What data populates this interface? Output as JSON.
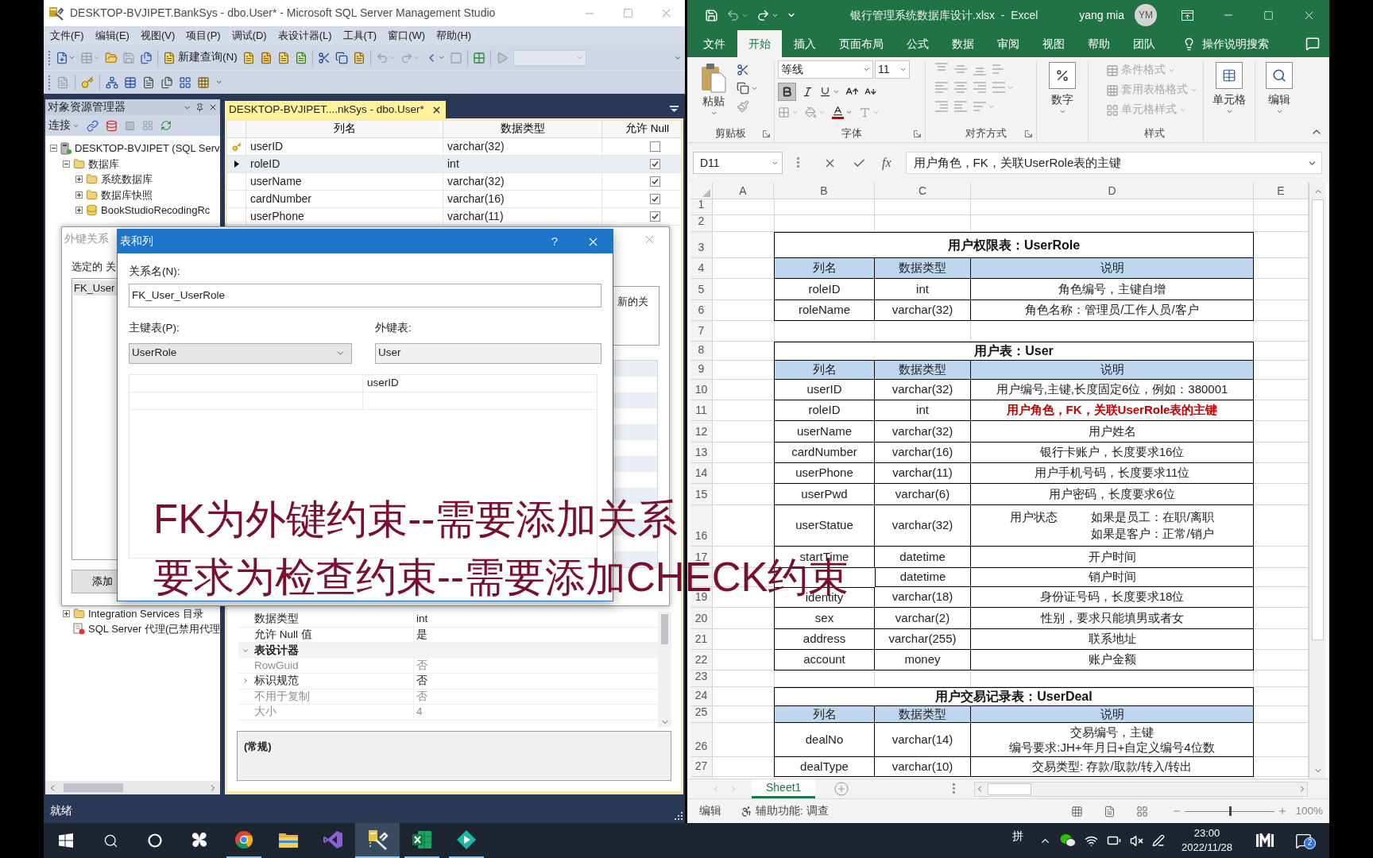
{
  "ssms": {
    "title": "DESKTOP-BVJIPET.BankSys - dbo.User* - Microsoft SQL Server Management Studio",
    "menu": [
      "文件(F)",
      "编辑(E)",
      "视图(V)",
      "项目(P)",
      "调试(D)",
      "表设计器(L)",
      "工具(T)",
      "窗口(W)",
      "帮助(H)"
    ],
    "new_query": "新建查询(N)",
    "object_explorer": {
      "title": "对象资源管理器",
      "connect": "连接",
      "tree": [
        {
          "label": "DESKTOP-BVJIPET (SQL Serv",
          "kind": "server",
          "expanded": true,
          "children": [
            {
              "label": "数据库",
              "kind": "folder",
              "expanded": true,
              "children": [
                {
                  "label": "系统数据库",
                  "kind": "folder",
                  "expanded": false
                },
                {
                  "label": "数据库快照",
                  "kind": "folder",
                  "expanded": false
                },
                {
                  "label": "BookStudioRecodingRc",
                  "kind": "database",
                  "expanded": false
                }
              ]
            },
            {
              "label": "Integration Services 目录",
              "kind": "folder",
              "expanded": false
            },
            {
              "label": "SQL Server 代理(已禁用代理",
              "kind": "agent"
            }
          ]
        }
      ]
    },
    "designer": {
      "tabs": [
        {
          "label": "DESKTOP-BVJIPET....nkSys - dbo.User*",
          "selected": true
        }
      ],
      "columns": [
        "列名",
        "数据类型",
        "允许 Null"
      ],
      "rows": [
        {
          "name": "userID",
          "type": "varchar(32)",
          "allow_null": false,
          "primary_key": true,
          "selected": false
        },
        {
          "name": "roleID",
          "type": "int",
          "allow_null": true,
          "primary_key": false,
          "selected": true
        },
        {
          "name": "userName",
          "type": "varchar(32)",
          "allow_null": true,
          "primary_key": false,
          "selected": false
        },
        {
          "name": "cardNumber",
          "type": "varchar(16)",
          "allow_null": true,
          "primary_key": false,
          "selected": false
        },
        {
          "name": "userPhone",
          "type": "varchar(11)",
          "allow_null": true,
          "primary_key": false,
          "selected": false
        }
      ],
      "properties": [
        {
          "kind": "property",
          "name": "数据类型",
          "value": "int",
          "disabled": false
        },
        {
          "kind": "property",
          "name": "允许 Null 值",
          "value": "是",
          "disabled": false
        },
        {
          "kind": "category",
          "name": "表设计器",
          "expanded": true
        },
        {
          "kind": "property",
          "name": "RowGuid",
          "value": "否",
          "disabled": true
        },
        {
          "kind": "property",
          "name": "标识规范",
          "value": "否",
          "disabled": false,
          "expanded": false
        },
        {
          "kind": "property",
          "name": "不用于复制",
          "value": "否",
          "disabled": true
        },
        {
          "kind": "property",
          "name": "大小",
          "value": "4",
          "disabled": true
        }
      ],
      "description": "(常规)"
    },
    "fk_dialog": {
      "title": "外键关系",
      "list_label": "选定的 关",
      "relationships": [
        {
          "label": "FK_User",
          "selected": true
        }
      ],
      "add": "添加",
      "detail": "新的关"
    },
    "columns_dialog": {
      "title": "表和列",
      "help": "?",
      "name_label": "关系名(N):",
      "name": "FK_User_UserRole",
      "primary_label": "主键表(P):",
      "primary_table": "UserRole",
      "foreign_label": "外键表:",
      "foreign_table": "User",
      "foreign_columns": [
        "userID"
      ]
    },
    "status": "就绪"
  },
  "caption": [
    "FK为外键约束--需要添加关系",
    "要求为检查约束--需要添加CHECK约束"
  ],
  "excel": {
    "title": "银行管理系统数据库设计.xlsx  -  Excel",
    "user": "yang mia",
    "initials": "YM",
    "tabs": [
      {
        "label": "文件",
        "selected": false
      },
      {
        "label": "开始",
        "selected": true
      },
      {
        "label": "插入",
        "selected": false
      },
      {
        "label": "页面布局",
        "selected": false
      },
      {
        "label": "公式",
        "selected": false
      },
      {
        "label": "数据",
        "selected": false
      },
      {
        "label": "审阅",
        "selected": false
      },
      {
        "label": "视图",
        "selected": false
      },
      {
        "label": "帮助",
        "selected": false
      },
      {
        "label": "团队",
        "selected": false
      }
    ],
    "search": "操作说明搜索",
    "ribbon": {
      "paste": "粘贴",
      "font": "等线",
      "size": "11",
      "bold": true,
      "alignment_disabled": true,
      "number": "数字",
      "styles": [
        {
          "label": "条件格式",
          "disabled": true
        },
        {
          "label": "套用表格格式",
          "disabled": true
        },
        {
          "label": "单元格样式",
          "disabled": true
        }
      ],
      "cells": "单元格",
      "editing": "编辑",
      "groups": [
        "剪贴板",
        "字体",
        "对齐方式",
        "样式"
      ]
    },
    "name_box": "D11",
    "fx": "fx",
    "formula": "用户角色，FK，关联UserRole表的主键",
    "columns": [
      "A",
      "B",
      "C",
      "D",
      "E"
    ],
    "rows": [
      {
        "num": "1",
        "kind": "blank"
      },
      {
        "num": "2",
        "kind": "blank"
      },
      {
        "num": "3",
        "kind": "title",
        "title": "用户权限表：UserRole"
      },
      {
        "num": "4",
        "kind": "header",
        "cells": [
          "列名",
          "数据类型",
          "说明"
        ]
      },
      {
        "num": "5",
        "kind": "data",
        "name": "roleID",
        "type": "int",
        "desc": "角色编号，主键自增"
      },
      {
        "num": "6",
        "kind": "data",
        "name": "roleName",
        "type": "varchar(32)",
        "desc": "角色名称：管理员/工作人员/客户"
      },
      {
        "num": "7",
        "kind": "blank"
      },
      {
        "num": "8",
        "kind": "title",
        "title": "用户表：User"
      },
      {
        "num": "9",
        "kind": "header",
        "cells": [
          "列名",
          "数据类型",
          "说明"
        ]
      },
      {
        "num": "10",
        "kind": "data",
        "name": "userID",
        "type": "varchar(32)",
        "desc": "用户编号,主键,长度固定6位，例如：380001"
      },
      {
        "num": "11",
        "kind": "data",
        "name": "roleID",
        "type": "int",
        "desc": "用户角色，FK，关联UserRole表的主键",
        "highlight": true
      },
      {
        "num": "12",
        "kind": "data",
        "name": "userName",
        "type": "varchar(32)",
        "desc": "用户姓名"
      },
      {
        "num": "13",
        "kind": "data",
        "name": "cardNumber",
        "type": "varchar(16)",
        "desc": "银行卡账户，长度要求16位"
      },
      {
        "num": "14",
        "kind": "data",
        "name": "userPhone",
        "type": "varchar(11)",
        "desc": "用户手机号码，长度要求11位"
      },
      {
        "num": "15",
        "kind": "data",
        "name": "userPwd",
        "type": "varchar(6)",
        "desc": "用户密码，长度要求6位"
      },
      {
        "num": "16",
        "kind": "data",
        "name": "userStatue",
        "type": "varchar(32)",
        "note": "用户状态",
        "lines": [
          "如果是员工：在职/离职",
          "如果是客户：正常/销户"
        ]
      },
      {
        "num": "17",
        "kind": "data",
        "name": "startTime",
        "type": "datetime",
        "desc": "开户时间"
      },
      {
        "kind": "data",
        "type": "datetime",
        "desc": "销户时间"
      },
      {
        "num": "19",
        "kind": "data",
        "name": "identity",
        "type": "varchar(18)",
        "desc": "身份证号码，长度要求18位"
      },
      {
        "num": "20",
        "kind": "data",
        "name": "sex",
        "type": "varchar(2)",
        "desc": "性别，要求只能填男或者女"
      },
      {
        "num": "21",
        "kind": "data",
        "name": "address",
        "type": "varchar(255)",
        "desc": "联系地址"
      },
      {
        "num": "22",
        "kind": "data",
        "name": "account",
        "type": "money",
        "desc": "账户金额"
      },
      {
        "num": "23",
        "kind": "blank"
      },
      {
        "num": "24",
        "kind": "title",
        "title": "用户交易记录表：UserDeal"
      },
      {
        "num": "25",
        "kind": "header",
        "cells": [
          "列名",
          "数据类型",
          "说明"
        ]
      },
      {
        "num": "26",
        "kind": "data",
        "name": "dealNo",
        "type": "varchar(14)",
        "lines": [
          "交易编号，主键",
          "编号要求:JH+年月日+自定义编号4位数"
        ]
      },
      {
        "num": "27",
        "kind": "data",
        "name": "dealType",
        "type": "varchar(10)",
        "desc": "交易类型: 存款/取款/转入/转出"
      }
    ],
    "sheets": [
      {
        "label": "Sheet1",
        "selected": true
      }
    ],
    "mode": "编辑",
    "accessibility": "辅助功能: 调查",
    "zoom_slider": {
      "level": 0.5
    },
    "zoom": "100%"
  },
  "taskbar": {
    "system": [
      {
        "kind": "start"
      },
      {
        "kind": "search"
      },
      {
        "kind": "assistant"
      }
    ],
    "apps": [
      {
        "kind": "pinwheel",
        "running": false,
        "selected": false
      },
      {
        "kind": "browser",
        "running": true,
        "selected": false
      },
      {
        "kind": "files",
        "running": false,
        "selected": false
      },
      {
        "kind": "ide",
        "running": false,
        "selected": false
      },
      {
        "kind": "dbtool",
        "running": true,
        "selected": true
      },
      {
        "kind": "sheet",
        "running": true,
        "selected": false
      },
      {
        "kind": "editor",
        "running": true,
        "selected": false
      }
    ],
    "ime": "拼",
    "time": "23:00",
    "date": "2022/11/28",
    "notifications": "2"
  }
}
